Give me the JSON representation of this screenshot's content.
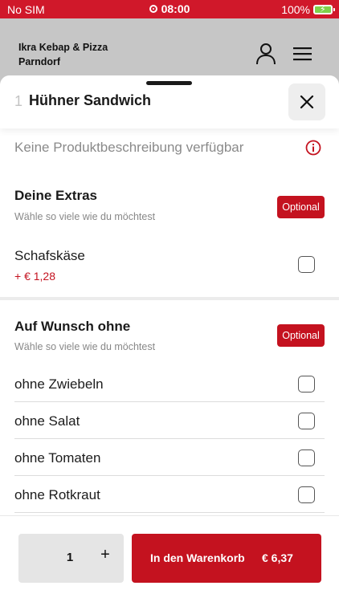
{
  "status_bar": {
    "carrier": "No SIM",
    "time": "08:00",
    "battery": "100%",
    "battery_level": 1.0
  },
  "app_header": {
    "restaurant_name": "Ikra Kebap & Pizza Parndorf",
    "icons": [
      "profile-icon",
      "hamburger-menu-icon"
    ]
  },
  "product": {
    "quantity_prefix": "1",
    "title": "Hühner Sandwich",
    "description": "Keine Produktbeschreibung verfügbar",
    "close_icon": "close-icon",
    "info_icon": "info-icon"
  },
  "groups": [
    {
      "title": "Deine Extras",
      "subtitle": "Wähle so viele wie du möchtest",
      "badge": "Optional",
      "options": [
        {
          "label": "Schafskäse",
          "price": "+ € 1,28",
          "checked": false
        }
      ]
    },
    {
      "title": "Auf Wunsch ohne",
      "subtitle": "Wähle so viele wie du möchtest",
      "badge": "Optional",
      "options": [
        {
          "label": "ohne Zwiebeln",
          "checked": false
        },
        {
          "label": "ohne Salat",
          "checked": false
        },
        {
          "label": "ohne Tomaten",
          "checked": false
        },
        {
          "label": "ohne Rotkraut",
          "checked": false
        }
      ]
    }
  ],
  "footer": {
    "quantity": "1",
    "plus": "+",
    "cart_label": "In den Warenkorb",
    "cart_price": "€ 6,37"
  },
  "colors": {
    "accent": "#c4121f",
    "status_bar": "#d0182a"
  }
}
